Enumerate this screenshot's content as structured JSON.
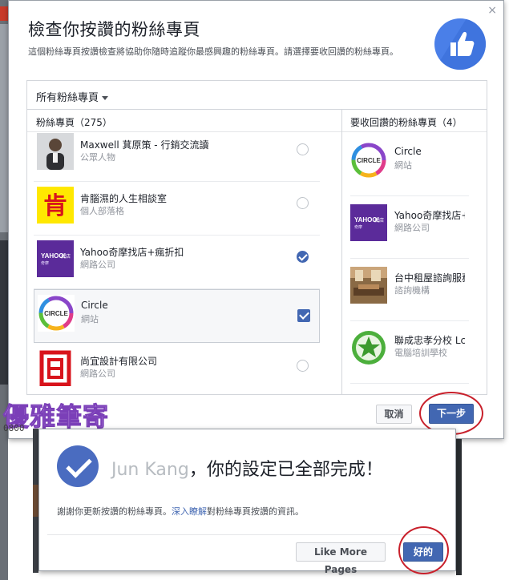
{
  "main_dialog": {
    "title": "檢查你按讚的粉絲專頁",
    "description": "這個粉絲專頁按讚檢查將協助你隨時追蹤你最感興趣的粉絲專頁。請選擇要收回讚的粉絲專頁。",
    "filter": "所有粉絲專頁",
    "left_header": "粉絲專頁（275）",
    "right_header": "要收回讚的粉絲專頁（4）",
    "pages": [
      {
        "name": "Maxwell 萁原策 - 行銷交流讀",
        "category": "公眾人物",
        "thumb": "person-photo",
        "state": "unselected"
      },
      {
        "name": "肯腦濕的人生相談室",
        "category": "個人部落格",
        "thumb": "yellow-ken-logo",
        "state": "unselected"
      },
      {
        "name": "Yahoo奇摩找店+瘋折扣",
        "category": "網路公司",
        "thumb": "yahoo-logo",
        "state": "selected"
      },
      {
        "name": "Circle",
        "category": "網站",
        "thumb": "circle-logo",
        "state": "checked"
      },
      {
        "name": "尚宜設計有限公司",
        "category": "網路公司",
        "thumb": "red-logo",
        "state": "unselected"
      }
    ],
    "unlike_pages": [
      {
        "name": "Circle",
        "category": "網站",
        "thumb": "circle-logo"
      },
      {
        "name": "Yahoo奇摩找店+",
        "category": "網路公司",
        "thumb": "yahoo-logo"
      },
      {
        "name": "台中租屋諮詢服務",
        "category": "諮詢機構",
        "thumb": "room-photo"
      },
      {
        "name": "聯成忠孝分校 Lc",
        "category": "電腦培訓學校",
        "thumb": "green-star-logo"
      }
    ],
    "cancel_label": "取消",
    "next_label": "下一步",
    "close_glyph": "×"
  },
  "watermark": {
    "text": "優雅筆寄",
    "number": "0800"
  },
  "done_dialog": {
    "ghost_name": "Jun Kang",
    "title": "，你的設定已全部完成！",
    "desc_prefix": "謝謝你更新按讚的粉絲專頁。",
    "desc_link": "深入瞭解",
    "desc_suffix": "對粉絲專頁按讚的資訊。",
    "like_more_label": "Like More Pages",
    "ok_label": "好的"
  },
  "colors": {
    "fb_blue": "#4267b2",
    "badge_blue": "#4a7fe8",
    "highlight_red": "#c8202b"
  }
}
